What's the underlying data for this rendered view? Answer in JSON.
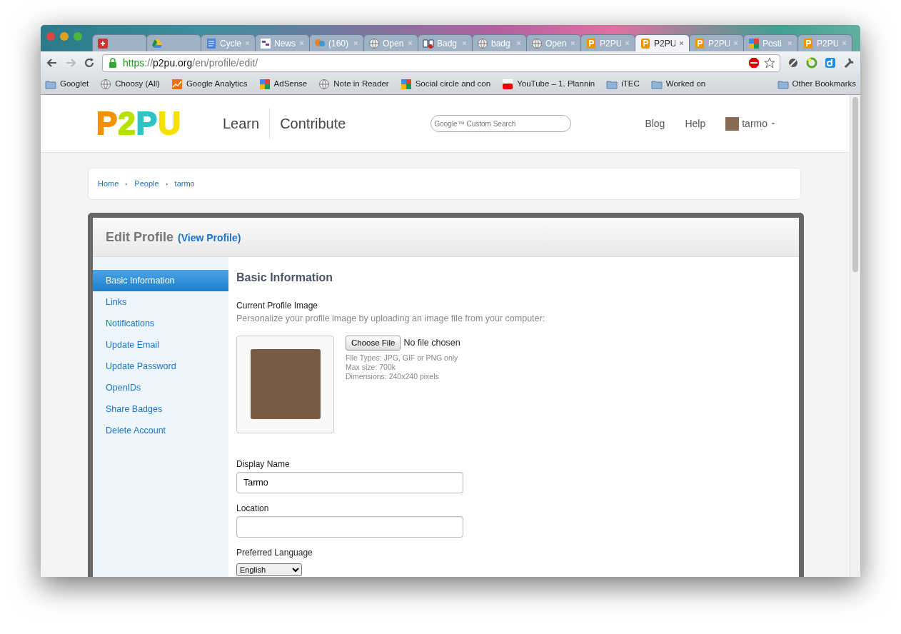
{
  "browser": {
    "tabs": [
      {
        "kind": "gplus",
        "selected": false
      },
      {
        "kind": "drive",
        "selected": false
      },
      {
        "kind": "doc",
        "label": "Cycle",
        "selected": false
      },
      {
        "kind": "news",
        "label": "News",
        "selected": false
      },
      {
        "kind": "chat",
        "label": "(160)",
        "selected": false
      },
      {
        "kind": "globe",
        "label": "Open",
        "selected": false
      },
      {
        "kind": "book",
        "label": "Badg",
        "selected": false
      },
      {
        "kind": "globe",
        "label": "badg",
        "selected": false
      },
      {
        "kind": "globe",
        "label": "Open",
        "selected": false
      },
      {
        "kind": "p2pu",
        "label": "P2PU",
        "selected": false
      },
      {
        "kind": "p2pu",
        "label": "P2PU",
        "selected": true
      },
      {
        "kind": "p2pu",
        "label": "P2PU",
        "selected": false
      },
      {
        "kind": "google",
        "label": "Posti",
        "selected": false
      },
      {
        "kind": "p2pu",
        "label": "P2PU",
        "selected": false
      }
    ],
    "address": {
      "scheme": "https",
      "separator": "://",
      "host": "p2pu.org",
      "path": "/en/profile/edit/"
    },
    "bookmarks": [
      {
        "kind": "folder",
        "label": "Googlet"
      },
      {
        "kind": "globe",
        "label": "Choosy (All)"
      },
      {
        "kind": "analytics",
        "label": "Google Analytics"
      },
      {
        "kind": "google",
        "label": "AdSense"
      },
      {
        "kind": "globe",
        "label": "Note in Reader"
      },
      {
        "kind": "google",
        "label": "Social circle and con"
      },
      {
        "kind": "youtube",
        "label": "YouTube – 1. Plannin"
      },
      {
        "kind": "folder",
        "label": "iTEC"
      },
      {
        "kind": "folder",
        "label": "Worked on"
      }
    ],
    "other_bookmarks": "Other Bookmarks"
  },
  "site": {
    "logo": "P2PU",
    "nav": [
      "Learn",
      "Contribute"
    ],
    "search": {
      "placeholder": "Google™ Custom Search"
    },
    "right_nav": [
      "Blog",
      "Help"
    ],
    "user": "tarmo",
    "breadcrumb": [
      "Home",
      "People",
      "tarmo"
    ],
    "panel": {
      "title": "Edit Profile",
      "view_link": "(View Profile)",
      "sidebar": [
        {
          "label": "Basic Information",
          "selected": true
        },
        {
          "label": "Links",
          "selected": false
        },
        {
          "label": "Notifications",
          "selected": false
        },
        {
          "label": "Update Email",
          "selected": false
        },
        {
          "label": "Update Password",
          "selected": false
        },
        {
          "label": "OpenIDs",
          "selected": false
        },
        {
          "label": "Share Badges",
          "selected": false
        },
        {
          "label": "Delete Account",
          "selected": false
        }
      ],
      "heading": "Basic Information",
      "image": {
        "label": "Current Profile Image",
        "hint": "Personalize your profile image by uploading an image file from your computer:",
        "button": "Choose File",
        "status": "No file chosen",
        "notes": [
          "File Types: JPG, GIF or PNG only",
          "Max size: 700k",
          "Dimensions: 240x240 pixels"
        ]
      },
      "fields": [
        {
          "kind": "text",
          "label": "Display Name",
          "value": "Tarmo"
        },
        {
          "kind": "text",
          "label": "Location"
        },
        {
          "kind": "select",
          "label": "Preferred Language",
          "value": "English"
        }
      ]
    }
  }
}
